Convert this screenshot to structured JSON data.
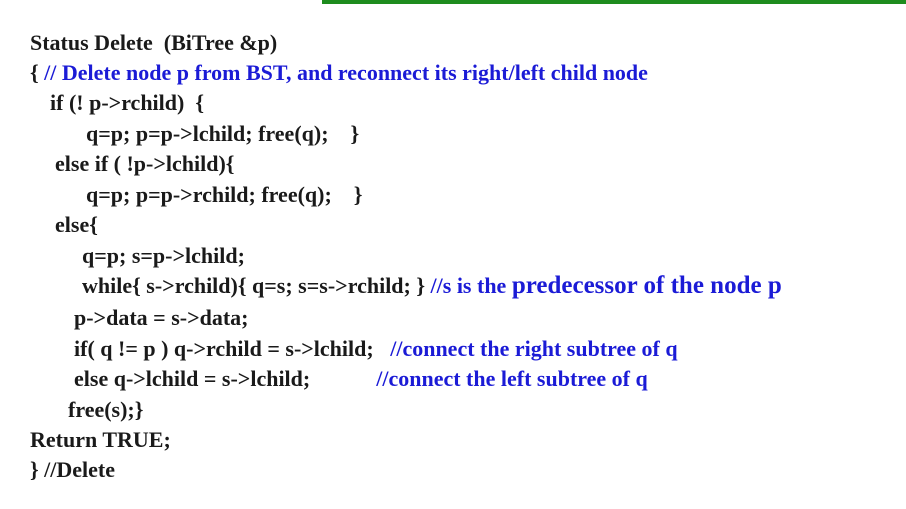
{
  "colors": {
    "code_text": "#1a1a1a",
    "comment_text": "#1b1bd6",
    "top_rule": "#1e8c1e"
  },
  "lines": [
    {
      "code": "Status Delete  (BiTree &p)"
    },
    {
      "code": "{ ",
      "comment": "// Delete node p from BST, and reconnect its right/left child node"
    },
    {
      "code": "if (! p->rchild)  {"
    },
    {
      "code": "q=p; p=p->lchild; free(q);    }"
    },
    {
      "code": "else if ( !p->lchild){"
    },
    {
      "code": "q=p; p=p->rchild; free(q);    }"
    },
    {
      "code": "else{"
    },
    {
      "code": "q=p; s=p->lchild;"
    },
    {
      "code": "while{ s->rchild){ q=s; s=s->rchild; } ",
      "comment": "//s is the ",
      "comment_big": "predecessor of the node p"
    },
    {
      "code": "p->data = s->data;"
    },
    {
      "code": "if( q != p ) q->rchild = s->lchild;   ",
      "comment": "//connect the right subtree of q"
    },
    {
      "code": "else q->lchild = s->lchild;            ",
      "comment": "//connect the left subtree of q"
    },
    {
      "code": "free(s);}"
    },
    {
      "code": "Return TRUE;"
    },
    {
      "code": "} //Delete"
    }
  ]
}
